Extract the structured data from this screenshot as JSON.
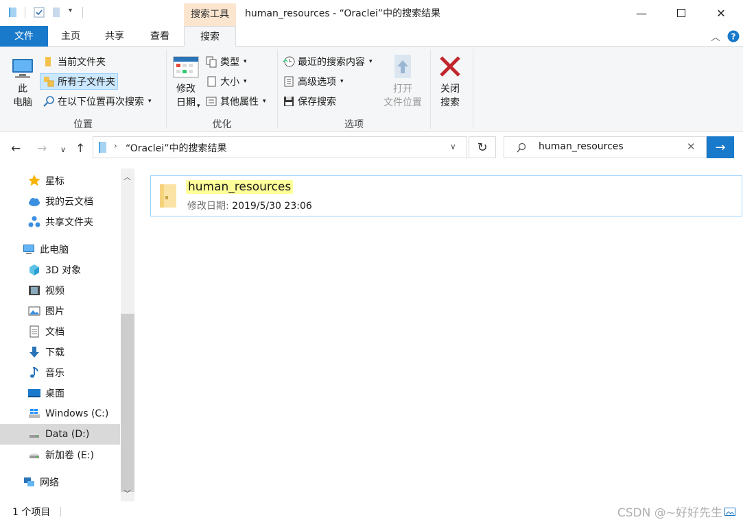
{
  "window": {
    "title": "human_resources - “Oraclei”中的搜索结果",
    "context_tab_group": "搜索工具"
  },
  "tabs": {
    "file": "文件",
    "home": "主页",
    "share": "共享",
    "view": "查看",
    "search": "搜索"
  },
  "ribbon": {
    "location": {
      "this_pc": "此\n电脑",
      "current_folder": "当前文件夹",
      "all_subfolders": "所有子文件夹",
      "search_again": "在以下位置再次搜索",
      "label": "位置"
    },
    "refine": {
      "date_modified": "修改\n日期",
      "kind": "类型",
      "size": "大小",
      "other_props": "其他属性",
      "label": "优化"
    },
    "options": {
      "recent_searches": "最近的搜索内容",
      "advanced": "高级选项",
      "save_search": "保存搜索",
      "open_location": "打开\n文件位置",
      "label": "选项"
    },
    "close": {
      "close_search": "关闭\n搜索"
    }
  },
  "address": {
    "path": "“Oraclei”中的搜索结果"
  },
  "search": {
    "query": "human_resources"
  },
  "nav": {
    "items": [
      {
        "label": "星标",
        "icon": "star-icon"
      },
      {
        "label": "我的云文档",
        "icon": "cloud-icon"
      },
      {
        "label": "共享文件夹",
        "icon": "share-icon"
      },
      {
        "label": "此电脑",
        "icon": "computer-icon"
      },
      {
        "label": "3D 对象",
        "icon": "cube-icon"
      },
      {
        "label": "视频",
        "icon": "video-icon"
      },
      {
        "label": "图片",
        "icon": "picture-icon"
      },
      {
        "label": "文档",
        "icon": "document-icon"
      },
      {
        "label": "下载",
        "icon": "download-icon"
      },
      {
        "label": "音乐",
        "icon": "music-icon"
      },
      {
        "label": "桌面",
        "icon": "desktop-icon"
      },
      {
        "label": "Windows (C:)",
        "icon": "windows-drive-icon"
      },
      {
        "label": "Data (D:)",
        "icon": "drive-icon",
        "selected": true
      },
      {
        "label": "新加卷 (E:)",
        "icon": "drive-icon"
      },
      {
        "label": "网络",
        "icon": "network-icon"
      }
    ]
  },
  "results": [
    {
      "name": "human_resources",
      "date_label": "修改日期:",
      "date": "2019/5/30 23:06"
    }
  ],
  "status": {
    "count": "1 个项目"
  },
  "watermark": "CSDN @~好好先生",
  "colors": {
    "accent": "#1979ca",
    "context_tab": "#fbe5cf",
    "highlight": "#ffff99",
    "selection_border": "#99d1ff"
  }
}
